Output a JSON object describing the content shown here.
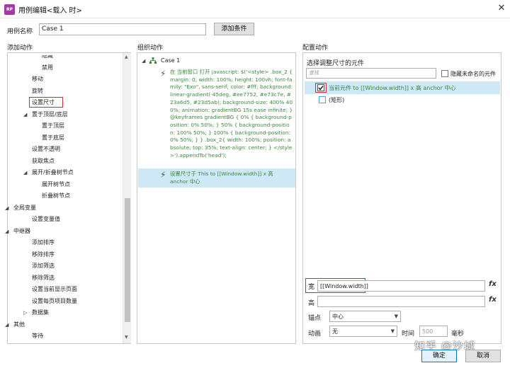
{
  "window": {
    "title": "用例编辑<载入 时>",
    "app_icon_text": "RP",
    "close_symbol": "✕"
  },
  "case_name": {
    "label": "用例名称",
    "value": "Case 1",
    "add_condition": "添加条件"
  },
  "sections": {
    "add_action": "添加动作",
    "organize_action": "组织动作",
    "configure_action": "配置动作"
  },
  "left_tree": {
    "items": [
      {
        "text": "隐藏",
        "indent": 2
      },
      {
        "text": "禁用",
        "indent": 2
      },
      {
        "text": "移动",
        "indent": 1
      },
      {
        "text": "旋转",
        "indent": 1
      },
      {
        "text": "设置尺寸",
        "indent": 1,
        "highlight": true
      },
      {
        "text": "置于顶层/底层",
        "indent": 1,
        "expandable": true
      },
      {
        "text": "置于顶层",
        "indent": 2
      },
      {
        "text": "置于底层",
        "indent": 2
      },
      {
        "text": "设置不透明",
        "indent": 1
      },
      {
        "text": "获取焦点",
        "indent": 1
      },
      {
        "text": "展开/折叠树节点",
        "indent": 1,
        "expandable": true
      },
      {
        "text": "展开树节点",
        "indent": 2
      },
      {
        "text": "折叠树节点",
        "indent": 2
      },
      {
        "text": "全局变量",
        "indent": 0,
        "expandable": true
      },
      {
        "text": "设置变量值",
        "indent": 1
      },
      {
        "text": "中继器",
        "indent": 0,
        "expandable": true
      },
      {
        "text": "添加排序",
        "indent": 1
      },
      {
        "text": "移除排序",
        "indent": 1
      },
      {
        "text": "添加筛选",
        "indent": 1
      },
      {
        "text": "移除筛选",
        "indent": 1
      },
      {
        "text": "设置当前显示页面",
        "indent": 1
      },
      {
        "text": "设置每页项目数量",
        "indent": 1
      },
      {
        "text": "数据集",
        "indent": 1,
        "collapsed": true
      },
      {
        "text": "其他",
        "indent": 0,
        "expandable": true
      },
      {
        "text": "等待",
        "indent": 1
      }
    ]
  },
  "organize": {
    "case_label": "Case 1",
    "action1": "在 当前窗口 打开 javascript: $('<style> .box_2 {     margin: 0;     width: 100%;     height: 100vh;     font-family: \"Exo\", sans-serif;     color: #fff;     background: linear-gradient(-45deg, #ee7752, #e73c7e, #23a6d5, #23d5ab);     background-size: 400% 400%;     animation: gradientBG 15s ease infinite; } @keyframes gradientBG {     0% {         background-position: 0% 50%;     }     50% {         background-position: 100% 50%;     }     100% {         background-position: 0% 50%;     } } .box_2{     width: 100%;     position: absolute;     top: 35%;     text-align: center; } </style>').appendTo('head');",
    "action2": "设置尺寸于 This to [[Window.width]] x 高 anchor 中心"
  },
  "configure": {
    "select_widget_label": "选择调整尺寸的元件",
    "search_placeholder": "查找",
    "hide_unnamed_label": "隐藏未命名的元件",
    "list": [
      {
        "text": "当前元件 to [[Window.width]] x 高 anchor 中心",
        "checked": true
      },
      {
        "text": "(矩形)",
        "checked": false
      }
    ],
    "width_label": "宽",
    "width_value": "[[Window.width]]",
    "height_label": "高",
    "height_value": "",
    "fx_label": "fx",
    "anchor_label": "锚点",
    "anchor_value": "中心",
    "animation_label": "动画",
    "animation_value": "无",
    "time_label": "时间",
    "time_value": "500",
    "ms_label": "毫秒"
  },
  "footer": {
    "ok": "确定",
    "cancel": "取消",
    "watermark": "知乎 @沙城"
  }
}
